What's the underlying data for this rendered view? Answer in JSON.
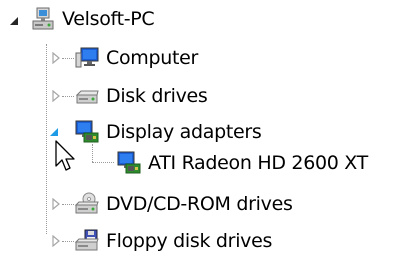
{
  "tree": {
    "root": {
      "label": "Velsoft-PC",
      "icon": "computer-network-icon",
      "expanded": true
    },
    "children": [
      {
        "label": "Computer",
        "icon": "computer-monitor-icon",
        "expanded": false
      },
      {
        "label": "Disk drives",
        "icon": "disk-drive-icon",
        "expanded": false
      },
      {
        "label": "Display adapters",
        "icon": "display-adapter-icon",
        "expanded": true,
        "children": [
          {
            "label": "ATI Radeon HD 2600 XT",
            "icon": "display-adapter-icon"
          }
        ]
      },
      {
        "label": "DVD/CD-ROM drives",
        "icon": "dvd-drive-icon",
        "expanded": false
      },
      {
        "label": "Floppy disk drives",
        "icon": "floppy-drive-icon",
        "expanded": false
      }
    ]
  },
  "colors": {
    "expander_collapsed": "#a6a6a6",
    "expander_hover": "#1e9be6",
    "expander_expanded": "#262626",
    "monitor_screen": "#1a5fd8",
    "card_green": "#2e8b2e"
  }
}
